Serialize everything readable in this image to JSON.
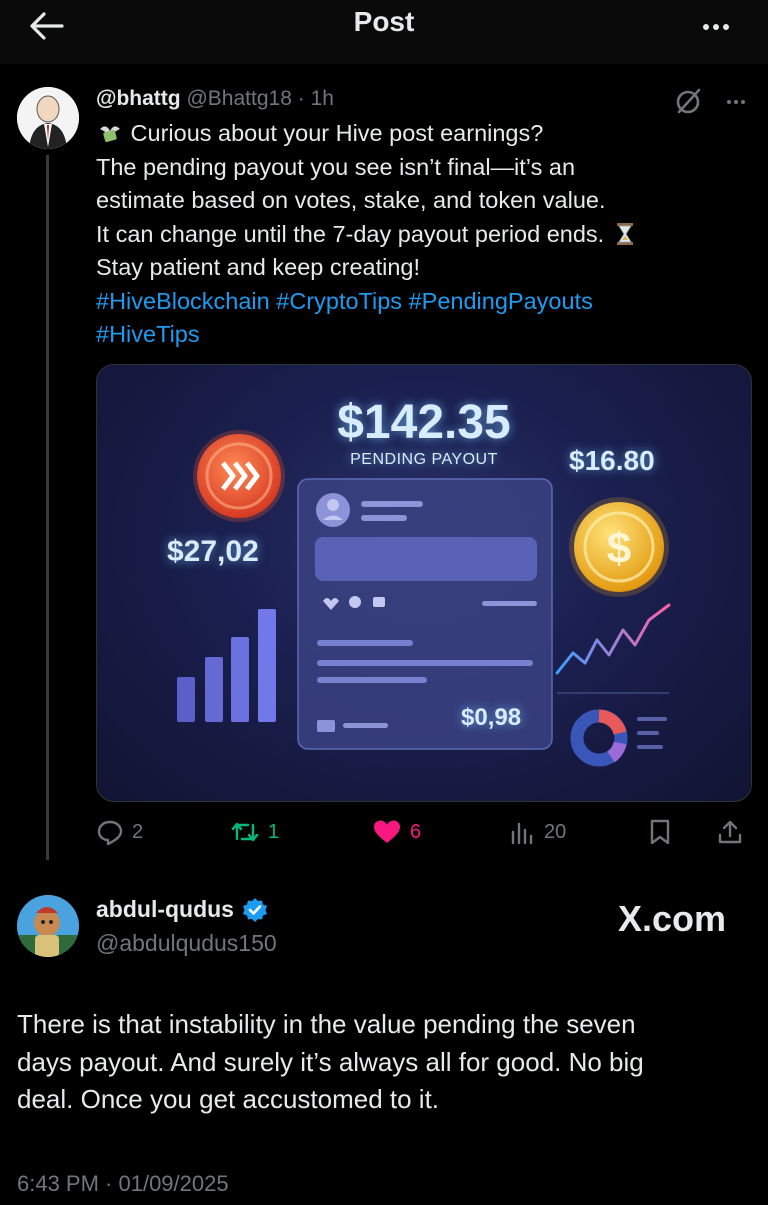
{
  "header": {
    "title": "Post",
    "back_icon": "arrow-left-icon",
    "more_icon": "more-icon"
  },
  "post": {
    "username": "@bhattg",
    "handle": "@Bhattg18",
    "separator": "·",
    "time": "1h",
    "lines": [
      "Curious about your Hive post earnings?",
      "The pending payout you see isn’t final—it’s an",
      "estimate based on votes, stake, and token value.",
      "It can change until the 7-day payout period ends."
    ],
    "line_last": "Stay patient and keep creating!",
    "hashtags_line1": "#HiveBlockchain #CryptoTips #PendingPayouts",
    "hashtags_line2": "#HiveTips",
    "image": {
      "main_amount": "$142.35",
      "main_label": "PENDING PAYOUT",
      "left_amount": "$27,02",
      "right_amount": "$16.80",
      "inner_amount": "$0,98"
    },
    "stats": {
      "replies": "2",
      "reposts": "1",
      "likes": "6",
      "views": "20"
    },
    "colors": {
      "link": "#1d9bf0",
      "repost": "#00ba7c",
      "like": "#f91880",
      "muted": "#71767b"
    }
  },
  "reply": {
    "display_name": "abdul-qudus",
    "handle": "@abdulqudus150",
    "watermark": "X.com",
    "lines": [
      "There is that instability in the value pending the seven",
      "days payout. And surely it’s always all for good. No big",
      "deal. Once you get accustomed to it."
    ],
    "timestamp": "6:43 PM · 01/09/2025"
  }
}
